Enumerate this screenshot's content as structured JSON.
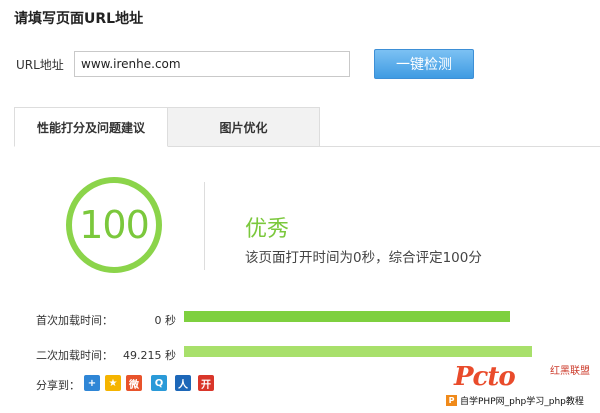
{
  "page_title": "请填写页面URL地址",
  "url_form": {
    "label": "URL地址",
    "value": "www.irenhe.com",
    "button_label": "一键检测"
  },
  "tabs": [
    {
      "label": "性能打分及问题建议",
      "active": true
    },
    {
      "label": "图片优化",
      "active": false
    }
  ],
  "score": {
    "value": "100",
    "grade": "优秀",
    "description": "该页面打开时间为0秒，综合评定100分",
    "ring_color": "#8bd44a"
  },
  "timings": [
    {
      "label": "首次加载时间：",
      "value": "0 秒",
      "fill_fraction": 0.93,
      "color": "#7ed03f"
    },
    {
      "label": "二次加载时间：",
      "value": "49.215 秒",
      "fill_fraction": 0.96,
      "color": "#a8e06b"
    }
  ],
  "share": {
    "label": "分享到：",
    "icons": [
      "qzone-plus-icon",
      "favorite-star-icon",
      "weibo-icon",
      "tencent-weibo-icon",
      "renren-icon",
      "kaixin-icon"
    ]
  },
  "watermark": {
    "logo_text": "Pcto",
    "side_text": "红黑联盟",
    "bar_badge": "P",
    "bar_text": "自学PHP网_php学习_php教程"
  }
}
